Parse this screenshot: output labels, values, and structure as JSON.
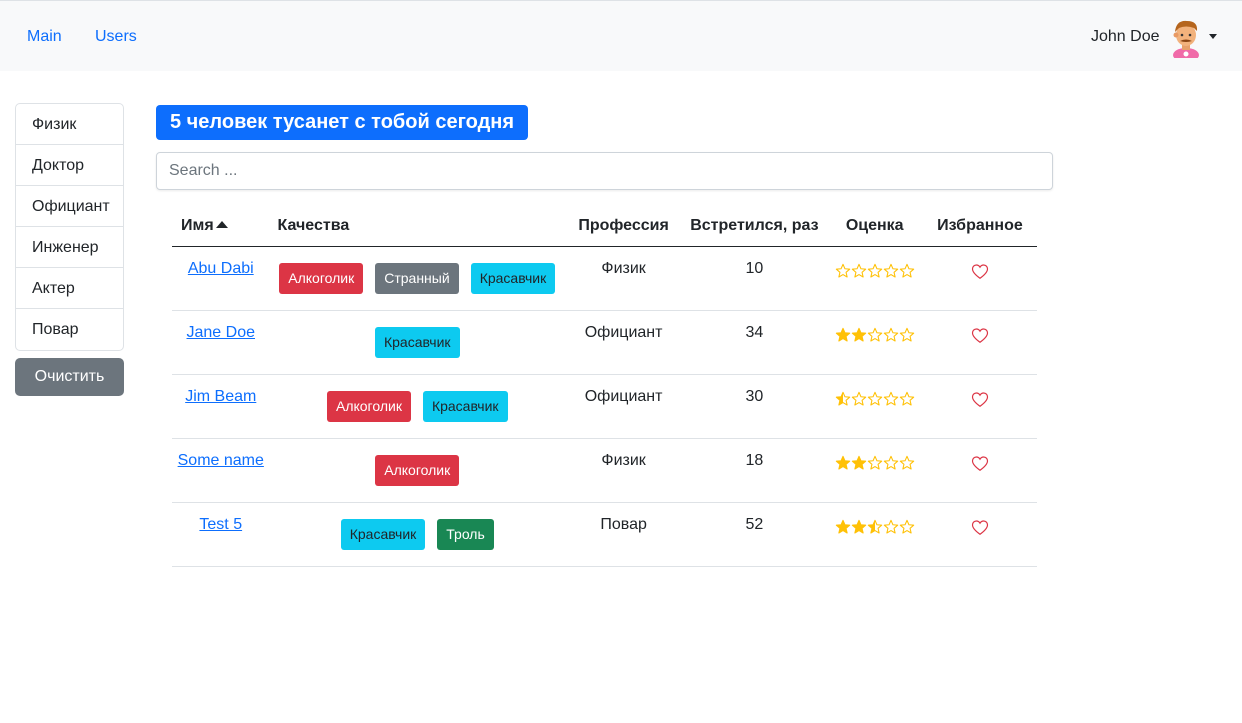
{
  "nav": {
    "main_label": "Main",
    "users_label": "Users",
    "user_name": "John Doe"
  },
  "sidebar": {
    "items": [
      "Физик",
      "Доктор",
      "Официант",
      "Инженер",
      "Актер",
      "Повар"
    ],
    "clear_label": "Очистить"
  },
  "headline": "5 человек тусанет с тобой сегодня",
  "search": {
    "placeholder": "Search ...",
    "value": ""
  },
  "table": {
    "headers": {
      "name": "Имя",
      "qualities": "Качества",
      "profession": "Профессия",
      "meetings": "Встретился, раз",
      "rating": "Оценка",
      "favorite": "Избранное"
    },
    "rows": [
      {
        "name": "Abu Dabi",
        "qualities": [
          {
            "label": "Алкоголик",
            "color": "danger"
          },
          {
            "label": "Странный",
            "color": "secondary"
          },
          {
            "label": "Красавчик",
            "color": "info"
          }
        ],
        "profession": "Физик",
        "meetings": "10",
        "rating": 0
      },
      {
        "name": "Jane Doe",
        "qualities": [
          {
            "label": "Красавчик",
            "color": "info"
          }
        ],
        "profession": "Официант",
        "meetings": "34",
        "rating": 2
      },
      {
        "name": "Jim Beam",
        "qualities": [
          {
            "label": "Алкоголик",
            "color": "danger"
          },
          {
            "label": "Красавчик",
            "color": "info"
          }
        ],
        "profession": "Официант",
        "meetings": "30",
        "rating": 0.5
      },
      {
        "name": "Some name",
        "qualities": [
          {
            "label": "Алкоголик",
            "color": "danger"
          }
        ],
        "profession": "Физик",
        "meetings": "18",
        "rating": 2
      },
      {
        "name": "Test 5",
        "qualities": [
          {
            "label": "Красавчик",
            "color": "info"
          },
          {
            "label": "Троль",
            "color": "success"
          }
        ],
        "profession": "Повар",
        "meetings": "52",
        "rating": 2.5
      }
    ]
  },
  "colors": {
    "primary": "#0d6efd",
    "star": "#ffc107",
    "heart": "#dc3545"
  }
}
